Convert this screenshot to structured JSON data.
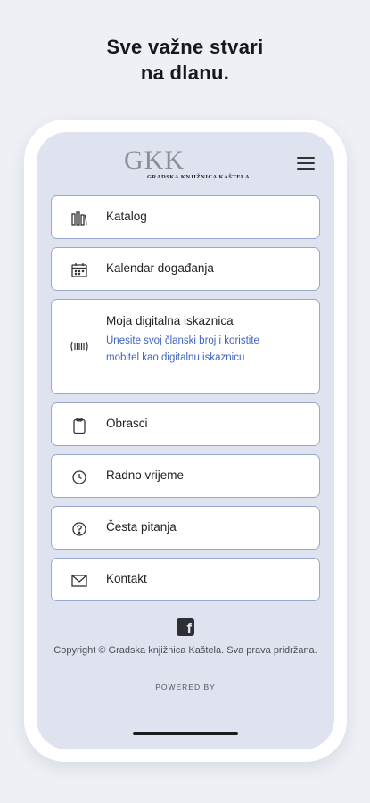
{
  "headline": {
    "line1": "Sve važne stvari",
    "line2": "na dlanu."
  },
  "logo": {
    "mark": "GKK",
    "subtitle": "GRADSKA KNJIŽNICA KAŠTELA"
  },
  "menu": [
    {
      "label": "Katalog",
      "icon": "catalog-icon"
    },
    {
      "label": "Kalendar događanja",
      "icon": "calendar-icon"
    },
    {
      "label": "Moja digitalna iskaznica",
      "icon": "barcode-icon",
      "sub": "Unesite svoj članski broj i koristite mobitel kao digitalnu iskaznicu"
    },
    {
      "label": "Obrasci",
      "icon": "clipboard-icon"
    },
    {
      "label": "Radno vrijeme",
      "icon": "clock-icon"
    },
    {
      "label": "Česta pitanja",
      "icon": "question-icon"
    },
    {
      "label": "Kontakt",
      "icon": "mail-icon"
    }
  ],
  "footer": {
    "copyright": "Copyright © Gradska knjižnica Kaštela. Sva prava pridržana.",
    "powered": "POWERED BY",
    "facebook_glyph": "f"
  },
  "colors": {
    "accent": "#3e63c2",
    "card_border": "#9aa7cf",
    "screen_bg": "#dfe3ef"
  }
}
